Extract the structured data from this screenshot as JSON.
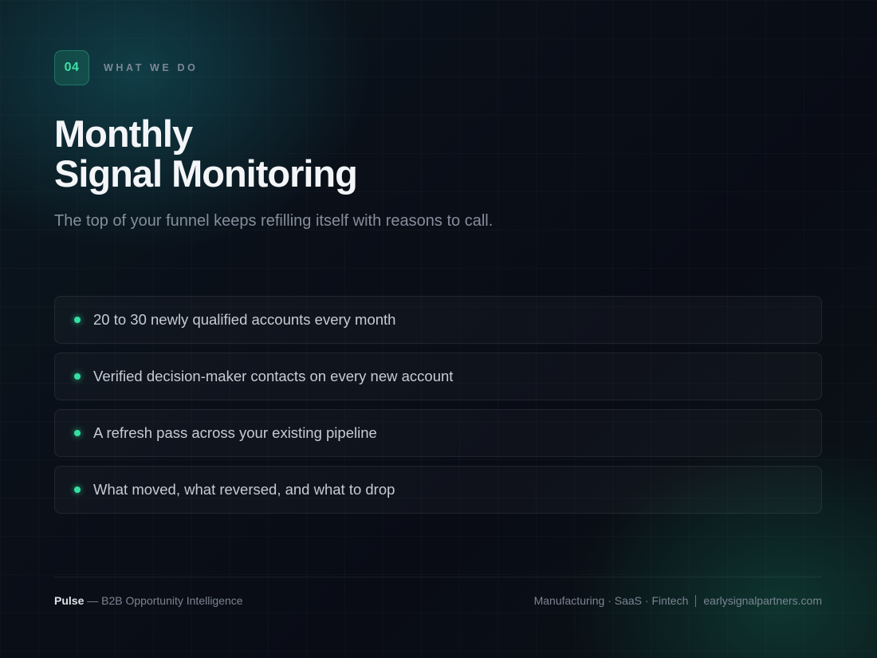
{
  "header": {
    "number": "04",
    "label": "WHAT WE DO"
  },
  "title": {
    "line1": "Monthly",
    "line2": "Signal Monitoring"
  },
  "subtitle": "The top of your funnel keeps refilling itself with reasons to call.",
  "items": [
    {
      "text": "20 to 30 newly qualified accounts every month"
    },
    {
      "text": "Verified decision-maker contacts on every new account"
    },
    {
      "text": "A refresh pass across your existing pipeline"
    },
    {
      "text": "What moved, what reversed, and what to drop"
    }
  ],
  "footer": {
    "brand": "Pulse",
    "tagline": " — B2B Opportunity Intelligence",
    "industries": "Manufacturing · SaaS · Fintech",
    "website": "earlysignalpartners.com"
  },
  "colors": {
    "accent": "#34e0a1",
    "background": "#0a0f18"
  }
}
